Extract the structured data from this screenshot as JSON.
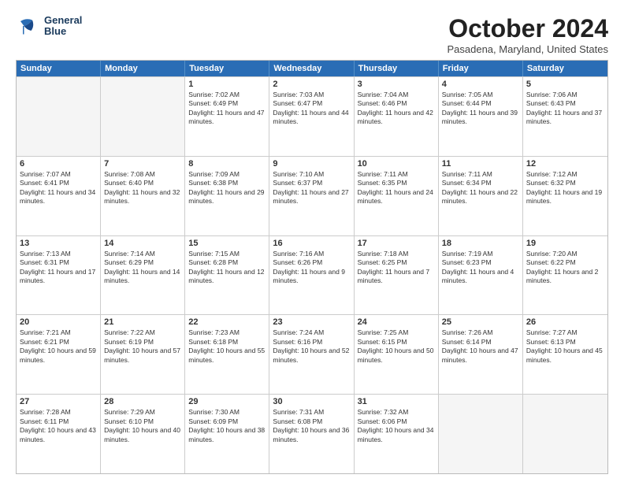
{
  "logo": {
    "line1": "General",
    "line2": "Blue"
  },
  "title": "October 2024",
  "subtitle": "Pasadena, Maryland, United States",
  "weekdays": [
    "Sunday",
    "Monday",
    "Tuesday",
    "Wednesday",
    "Thursday",
    "Friday",
    "Saturday"
  ],
  "rows": [
    [
      {
        "day": "",
        "info": ""
      },
      {
        "day": "",
        "info": ""
      },
      {
        "day": "1",
        "info": "Sunrise: 7:02 AM\nSunset: 6:49 PM\nDaylight: 11 hours and 47 minutes."
      },
      {
        "day": "2",
        "info": "Sunrise: 7:03 AM\nSunset: 6:47 PM\nDaylight: 11 hours and 44 minutes."
      },
      {
        "day": "3",
        "info": "Sunrise: 7:04 AM\nSunset: 6:46 PM\nDaylight: 11 hours and 42 minutes."
      },
      {
        "day": "4",
        "info": "Sunrise: 7:05 AM\nSunset: 6:44 PM\nDaylight: 11 hours and 39 minutes."
      },
      {
        "day": "5",
        "info": "Sunrise: 7:06 AM\nSunset: 6:43 PM\nDaylight: 11 hours and 37 minutes."
      }
    ],
    [
      {
        "day": "6",
        "info": "Sunrise: 7:07 AM\nSunset: 6:41 PM\nDaylight: 11 hours and 34 minutes."
      },
      {
        "day": "7",
        "info": "Sunrise: 7:08 AM\nSunset: 6:40 PM\nDaylight: 11 hours and 32 minutes."
      },
      {
        "day": "8",
        "info": "Sunrise: 7:09 AM\nSunset: 6:38 PM\nDaylight: 11 hours and 29 minutes."
      },
      {
        "day": "9",
        "info": "Sunrise: 7:10 AM\nSunset: 6:37 PM\nDaylight: 11 hours and 27 minutes."
      },
      {
        "day": "10",
        "info": "Sunrise: 7:11 AM\nSunset: 6:35 PM\nDaylight: 11 hours and 24 minutes."
      },
      {
        "day": "11",
        "info": "Sunrise: 7:11 AM\nSunset: 6:34 PM\nDaylight: 11 hours and 22 minutes."
      },
      {
        "day": "12",
        "info": "Sunrise: 7:12 AM\nSunset: 6:32 PM\nDaylight: 11 hours and 19 minutes."
      }
    ],
    [
      {
        "day": "13",
        "info": "Sunrise: 7:13 AM\nSunset: 6:31 PM\nDaylight: 11 hours and 17 minutes."
      },
      {
        "day": "14",
        "info": "Sunrise: 7:14 AM\nSunset: 6:29 PM\nDaylight: 11 hours and 14 minutes."
      },
      {
        "day": "15",
        "info": "Sunrise: 7:15 AM\nSunset: 6:28 PM\nDaylight: 11 hours and 12 minutes."
      },
      {
        "day": "16",
        "info": "Sunrise: 7:16 AM\nSunset: 6:26 PM\nDaylight: 11 hours and 9 minutes."
      },
      {
        "day": "17",
        "info": "Sunrise: 7:18 AM\nSunset: 6:25 PM\nDaylight: 11 hours and 7 minutes."
      },
      {
        "day": "18",
        "info": "Sunrise: 7:19 AM\nSunset: 6:23 PM\nDaylight: 11 hours and 4 minutes."
      },
      {
        "day": "19",
        "info": "Sunrise: 7:20 AM\nSunset: 6:22 PM\nDaylight: 11 hours and 2 minutes."
      }
    ],
    [
      {
        "day": "20",
        "info": "Sunrise: 7:21 AM\nSunset: 6:21 PM\nDaylight: 10 hours and 59 minutes."
      },
      {
        "day": "21",
        "info": "Sunrise: 7:22 AM\nSunset: 6:19 PM\nDaylight: 10 hours and 57 minutes."
      },
      {
        "day": "22",
        "info": "Sunrise: 7:23 AM\nSunset: 6:18 PM\nDaylight: 10 hours and 55 minutes."
      },
      {
        "day": "23",
        "info": "Sunrise: 7:24 AM\nSunset: 6:16 PM\nDaylight: 10 hours and 52 minutes."
      },
      {
        "day": "24",
        "info": "Sunrise: 7:25 AM\nSunset: 6:15 PM\nDaylight: 10 hours and 50 minutes."
      },
      {
        "day": "25",
        "info": "Sunrise: 7:26 AM\nSunset: 6:14 PM\nDaylight: 10 hours and 47 minutes."
      },
      {
        "day": "26",
        "info": "Sunrise: 7:27 AM\nSunset: 6:13 PM\nDaylight: 10 hours and 45 minutes."
      }
    ],
    [
      {
        "day": "27",
        "info": "Sunrise: 7:28 AM\nSunset: 6:11 PM\nDaylight: 10 hours and 43 minutes."
      },
      {
        "day": "28",
        "info": "Sunrise: 7:29 AM\nSunset: 6:10 PM\nDaylight: 10 hours and 40 minutes."
      },
      {
        "day": "29",
        "info": "Sunrise: 7:30 AM\nSunset: 6:09 PM\nDaylight: 10 hours and 38 minutes."
      },
      {
        "day": "30",
        "info": "Sunrise: 7:31 AM\nSunset: 6:08 PM\nDaylight: 10 hours and 36 minutes."
      },
      {
        "day": "31",
        "info": "Sunrise: 7:32 AM\nSunset: 6:06 PM\nDaylight: 10 hours and 34 minutes."
      },
      {
        "day": "",
        "info": ""
      },
      {
        "day": "",
        "info": ""
      }
    ]
  ]
}
